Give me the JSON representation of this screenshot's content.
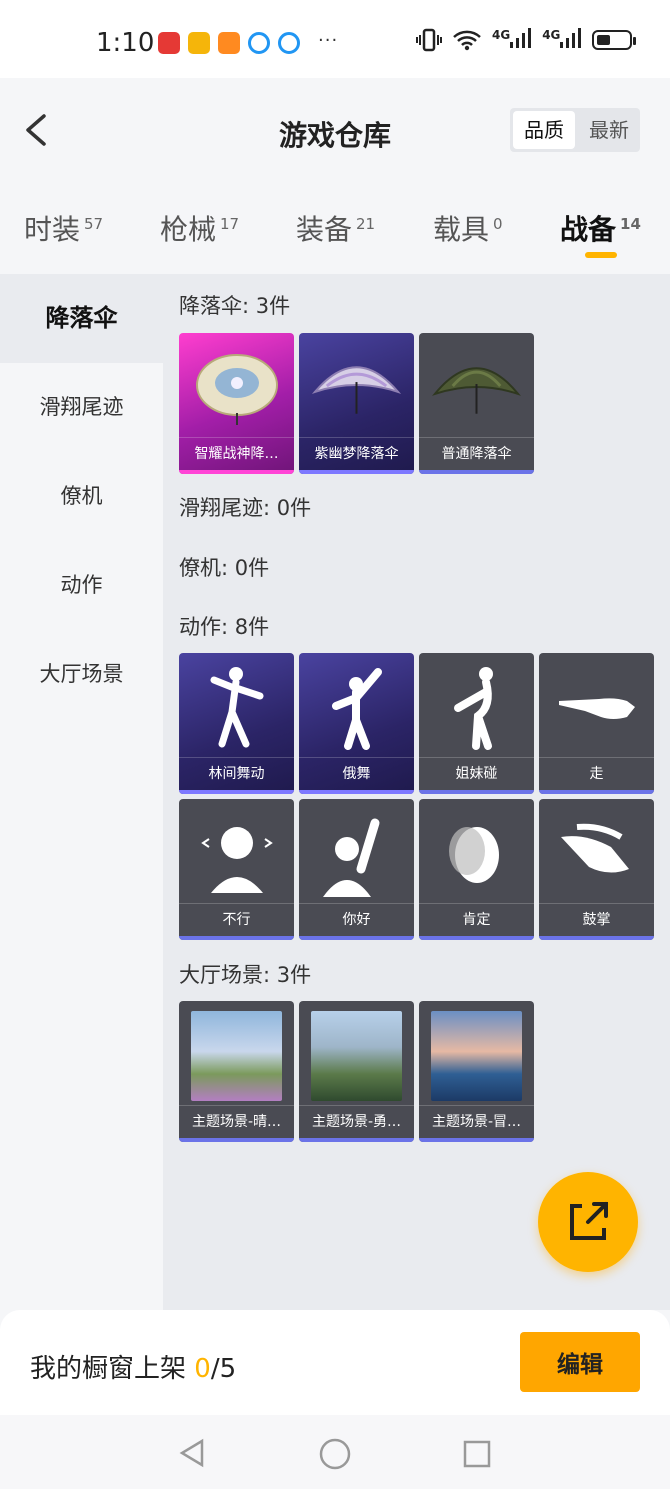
{
  "status_bar": {
    "time": "1:10",
    "dots": "···",
    "signal_1": "4G",
    "signal_2": "4G",
    "battery_level": 0.45
  },
  "header": {
    "title": "游戏仓库",
    "sort_options": [
      "品质",
      "最新"
    ],
    "sort_active": "品质"
  },
  "tabs": [
    {
      "label": "时装",
      "count": "57"
    },
    {
      "label": "枪械",
      "count": "17"
    },
    {
      "label": "装备",
      "count": "21"
    },
    {
      "label": "载具",
      "count": "0"
    },
    {
      "label": "战备",
      "count": "14",
      "active": true
    }
  ],
  "sidebar": [
    "降落伞",
    "滑翔尾迹",
    "僚机",
    "动作",
    "大厅场景"
  ],
  "sections": {
    "parachute": {
      "title": "降落伞: 3件",
      "items": [
        "智耀战神降…",
        "紫幽梦降落伞",
        "普通降落伞"
      ]
    },
    "glide_trail": {
      "title": "滑翔尾迹: 0件"
    },
    "wingman": {
      "title": "僚机: 0件"
    },
    "emote": {
      "title": "动作: 8件",
      "items": [
        "林间舞动",
        "俄舞",
        "姐妹碰",
        "走",
        "不行",
        "你好",
        "肯定",
        "鼓掌"
      ]
    },
    "lobby": {
      "title": "大厅场景: 3件",
      "items": [
        "主题场景-晴…",
        "主题场景-勇…",
        "主题场景-冒…"
      ]
    }
  },
  "bottom": {
    "showcase_label": "我的橱窗上架 ",
    "showcase_count": "0",
    "showcase_total": "/5",
    "edit_label": "编辑"
  },
  "colors": {
    "accent": "#ffb400",
    "legendary": "#ff3ecf",
    "epic": "#4a43a0",
    "common": "#4a4b53"
  }
}
